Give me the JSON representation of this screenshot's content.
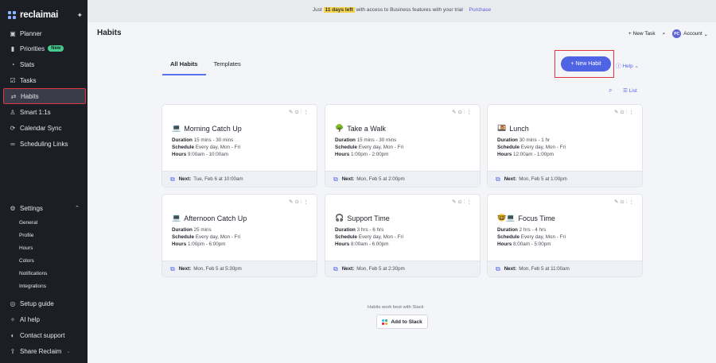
{
  "app": {
    "name": "reclaimai"
  },
  "sidebar": {
    "items": [
      {
        "label": "Planner",
        "icon": "calendar-icon",
        "glyph": "▣"
      },
      {
        "label": "Priorities",
        "icon": "bars-icon",
        "glyph": "▮",
        "badge": "New"
      },
      {
        "label": "Stats",
        "icon": "stats-icon",
        "glyph": "◔"
      },
      {
        "label": "Tasks",
        "icon": "tasks-icon",
        "glyph": "☑"
      },
      {
        "label": "Habits",
        "icon": "habits-icon",
        "glyph": "⇄"
      },
      {
        "label": "Smart 1:1s",
        "icon": "people-icon",
        "glyph": "♙"
      },
      {
        "label": "Calendar Sync",
        "icon": "sync-icon",
        "glyph": "⟳"
      },
      {
        "label": "Scheduling Links",
        "icon": "link-icon",
        "glyph": "∞"
      }
    ],
    "settings": {
      "label": "Settings",
      "glyph": "⚙",
      "sub": [
        "General",
        "Profile",
        "Hours",
        "Colors",
        "Notifications",
        "Integrations"
      ]
    },
    "bottom": [
      {
        "label": "Setup guide",
        "glyph": "◎"
      },
      {
        "label": "AI help",
        "glyph": "✧"
      },
      {
        "label": "Contact support",
        "glyph": "◐"
      },
      {
        "label": "Share Reclaim",
        "glyph": "⇪"
      }
    ]
  },
  "banner": {
    "prefix": "Just",
    "highlight": "11 days left",
    "suffix": "with access to Business features with your trial",
    "link": "Purchase"
  },
  "header": {
    "title": "Habits",
    "new_task": "+ New Task",
    "account_initials": "PC",
    "account_label": "Account"
  },
  "tabs": [
    "All Habits",
    "Templates"
  ],
  "actions": {
    "new_habit": "+ New Habit",
    "help": "Help",
    "list": "List"
  },
  "labels": {
    "duration": "Duration",
    "schedule": "Schedule",
    "hours": "Hours",
    "next": "Next:"
  },
  "habits": [
    {
      "title": "Morning Catch Up",
      "emoji": "💻",
      "duration": "15 mins - 30 mins",
      "schedule": "Every day, Mon - Fri",
      "hours": "9:00am - 10:00am",
      "next": "Tue, Feb 6 at 10:00am"
    },
    {
      "title": "Take a Walk",
      "emoji": "🌳",
      "duration": "15 mins - 30 mins",
      "schedule": "Every day, Mon - Fri",
      "hours": "1:00pm - 2:00pm",
      "next": "Mon, Feb 5 at 2:00pm"
    },
    {
      "title": "Lunch",
      "emoji": "🍱",
      "duration": "30 mins - 1 hr",
      "schedule": "Every day, Mon - Fri",
      "hours": "12:00am - 1:00pm",
      "next": "Mon, Feb 5 at 1:00pm"
    },
    {
      "title": "Afternoon Catch Up",
      "emoji": "💻",
      "duration": "25 mins",
      "schedule": "Every day, Mon - Fri",
      "hours": "1:00pm - 6:00pm",
      "next": "Mon, Feb 5 at 5:30pm"
    },
    {
      "title": "Support Time",
      "emoji": "🎧",
      "duration": "3 hrs - 6 hrs",
      "schedule": "Every day, Mon - Fri",
      "hours": "8:00am - 6:00pm",
      "next": "Mon, Feb 5 at 2:30pm"
    },
    {
      "title": "Focus Time",
      "emoji": "🤓💻",
      "duration": "2 hrs - 4 hrs",
      "schedule": "Every day, Mon - Fri",
      "hours": "8:00am - 5:00pm",
      "next": "Mon, Feb 5 at 11:00am"
    }
  ],
  "slack": {
    "note": "Habits work best with Slack",
    "button": "Add to Slack"
  },
  "colors": {
    "sidebar_bg": "#1c1e26",
    "accent": "#4f64e4",
    "highlight_border": "#e0383e",
    "new_badge": "#49c98b"
  }
}
